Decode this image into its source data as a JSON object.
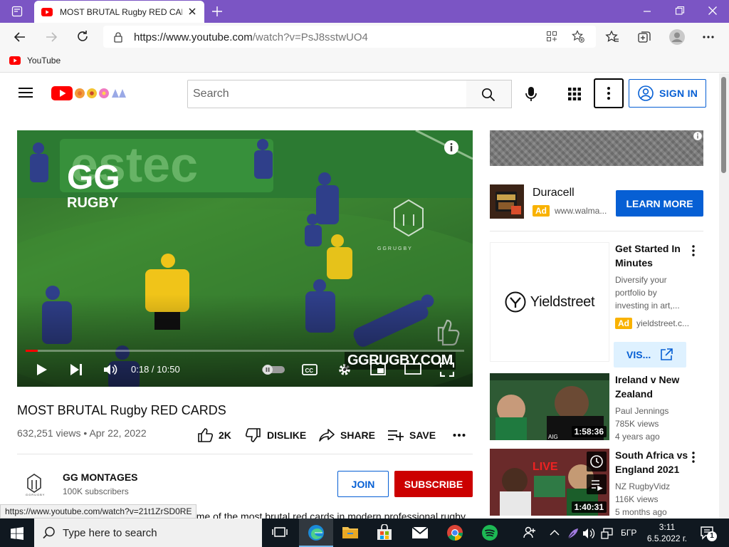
{
  "browser": {
    "tab_title": "MOST BRUTAL Rugby RED CARDS",
    "url_host": "https://www.youtube.com",
    "url_path": "/watch?v=PsJ8sstwUO4",
    "bookmark_label": "YouTube",
    "status_url": "https://www.youtube.com/watch?v=21t1ZrSD0RE"
  },
  "youtube_header": {
    "search_placeholder": "Search",
    "sign_in_label": "SIGN IN"
  },
  "video_player": {
    "watermark_title": "GG",
    "watermark_sub": "RUGBY",
    "logo_text": "GGRUGBY",
    "overlay_url": "GGRUGBY.COM",
    "time_display": "0:18 / 10:50",
    "progress_fraction": 0.028
  },
  "video_info": {
    "title": "MOST BRUTAL Rugby RED CARDS",
    "views": "632,251 views",
    "date": "Apr 22, 2022",
    "meta_separator": " • ",
    "likes_label": "2K",
    "dislike_label": "DISLIKE",
    "share_label": "SHARE",
    "save_label": "SAVE"
  },
  "channel": {
    "name": "GG MONTAGES",
    "subscribers": "100K subscribers",
    "join_label": "JOIN",
    "subscribe_label": "SUBSCRIBE",
    "description_partial": "ome of the most brutal red cards in modern professional rugby"
  },
  "sidebar": {
    "duracell_ad": {
      "brand": "Duracell",
      "badge": "Ad",
      "domain": "www.walma...",
      "cta": "LEARN MORE"
    },
    "yieldstreet_ad": {
      "logo_text": "Yieldstreet",
      "title_line1": "Get Started In",
      "title_line2": "Minutes",
      "desc_line1": "Diversify your",
      "desc_line2": "portfolio by",
      "desc_line3": "investing in art,...",
      "badge": "Ad",
      "domain": "yieldstreet.c...",
      "cta": "VIS..."
    },
    "videos": [
      {
        "title_line1": "Ireland v New",
        "title_line2": "Zealand",
        "channel": "Paul Jennings",
        "views": "785K views",
        "age": "4 years ago",
        "duration": "1:58:36"
      },
      {
        "title_line1": "South Africa vs",
        "title_line2": "England 2021",
        "channel": "NZ RugbyVidz",
        "views": "116K views",
        "age": "5 months ago",
        "duration": "1:40:31",
        "thumb_text": "LIVE"
      }
    ]
  },
  "taskbar": {
    "search_placeholder": "Type here to search",
    "language": "БГР",
    "time": "3:11",
    "date": "6.5.2022 г.",
    "notification_count": "1"
  },
  "colors": {
    "browser_accent": "#7b55c4",
    "youtube_red": "#ff0000",
    "subscribe_red": "#cc0000",
    "link_blue": "#065fd4",
    "ad_yellow": "#f9b200"
  }
}
